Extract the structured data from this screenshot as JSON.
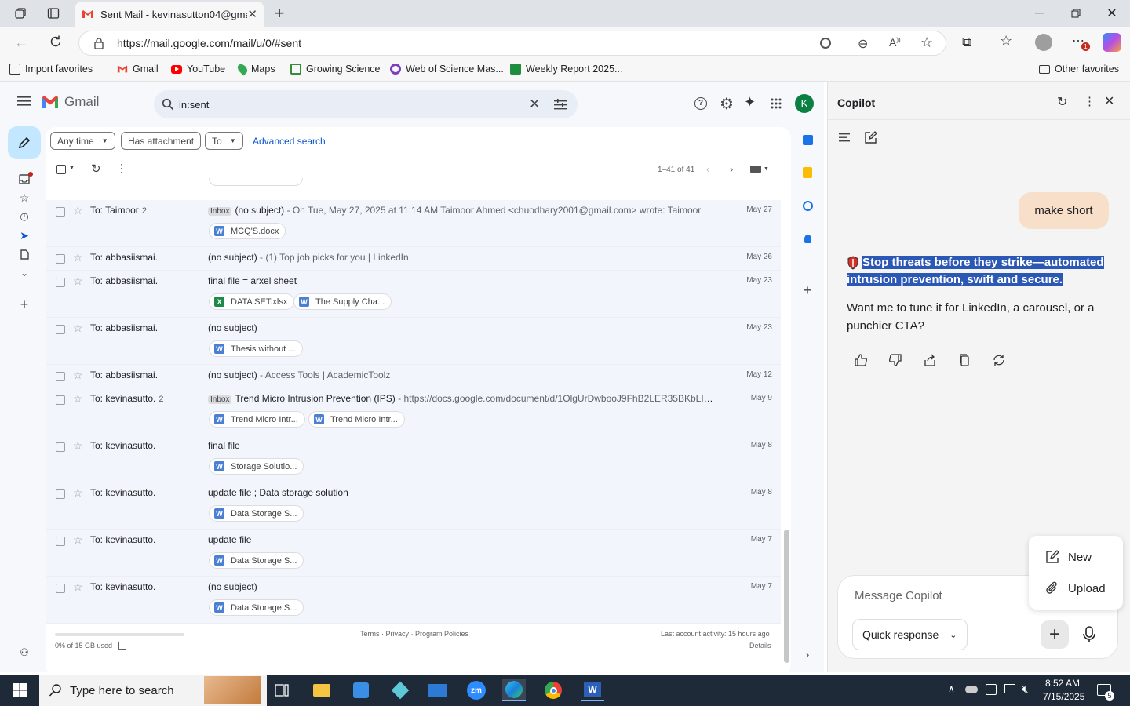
{
  "browser": {
    "tab_title": "Sent Mail - kevinasutton04@gma",
    "url": "https://mail.google.com/mail/u/0/#sent",
    "favorites": [
      {
        "label": "Import favorites",
        "icon": "import-icon"
      },
      {
        "label": "Gmail",
        "icon": "gmail-icon"
      },
      {
        "label": "YouTube",
        "icon": "youtube-icon"
      },
      {
        "label": "Maps",
        "icon": "maps-icon"
      },
      {
        "label": "Growing Science",
        "icon": "growing-science-icon"
      },
      {
        "label": "Web of Science Mas...",
        "icon": "web-of-science-icon"
      },
      {
        "label": "Weekly Report 2025...",
        "icon": "sheets-icon"
      }
    ],
    "other_favorites": "Other favorites",
    "notification_count": "1"
  },
  "gmail": {
    "logo_text": "Gmail",
    "search_value": "in:sent",
    "account_initial": "K",
    "filters": [
      "Any time",
      "Has attachment",
      "To"
    ],
    "advanced_search": "Advanced search",
    "pagination": "1–41 of 41",
    "rows": [
      {
        "to": "To: Taimoor",
        "count": "2",
        "badge": "Inbox",
        "subject": "(no subject)",
        "snippet": " - On Tue, May 27, 2025 at 11:14 AM Taimoor Ahmed <chuodhary2001@gmail.com> wrote: Taimoor",
        "date": "May 27",
        "attachments": [
          {
            "name": "MCQ'S.docx",
            "type": "W"
          }
        ]
      },
      {
        "to": "To: abbasiismai.",
        "count": "",
        "badge": "",
        "subject": "(no subject)",
        "snippet": " - (1) Top job picks for you | LinkedIn",
        "date": "May 26",
        "attachments": []
      },
      {
        "to": "To: abbasiismai.",
        "count": "",
        "badge": "",
        "subject": "final file = arxel sheet",
        "snippet": "",
        "date": "May 23",
        "attachments": [
          {
            "name": "DATA SET.xlsx",
            "type": "X"
          },
          {
            "name": "The Supply Cha...",
            "type": "W"
          }
        ]
      },
      {
        "to": "To: abbasiismai.",
        "count": "",
        "badge": "",
        "subject": "(no subject)",
        "snippet": "",
        "date": "May 23",
        "attachments": [
          {
            "name": "Thesis without ...",
            "type": "W"
          }
        ]
      },
      {
        "to": "To: abbasiismai.",
        "count": "",
        "badge": "",
        "subject": "(no subject)",
        "snippet": " - Access Tools | AcademicToolz",
        "date": "May 12",
        "attachments": []
      },
      {
        "to": "To: kevinasutto.",
        "count": "2",
        "badge": "Inbox",
        "subject": "Trend Micro Intrusion Prevention (IPS)",
        "snippet": " - https://docs.google.com/document/d/1OlgUrDwbooJ9FhB2LER35BKbLI9UNuno/edit?usp...",
        "date": "May 9",
        "attachments": [
          {
            "name": "Trend Micro Intr...",
            "type": "W"
          },
          {
            "name": "Trend Micro Intr...",
            "type": "W"
          }
        ]
      },
      {
        "to": "To: kevinasutto.",
        "count": "",
        "badge": "",
        "subject": "final file",
        "snippet": "",
        "date": "May 8",
        "attachments": [
          {
            "name": "Storage Solutio...",
            "type": "W"
          }
        ]
      },
      {
        "to": "To: kevinasutto.",
        "count": "",
        "badge": "",
        "subject": "update file ; Data storage solution",
        "snippet": "",
        "date": "May 8",
        "attachments": [
          {
            "name": "Data Storage S...",
            "type": "W"
          }
        ]
      },
      {
        "to": "To: kevinasutto.",
        "count": "",
        "badge": "",
        "subject": "update file",
        "snippet": "",
        "date": "May 7",
        "attachments": [
          {
            "name": "Data Storage S...",
            "type": "W"
          }
        ]
      },
      {
        "to": "To: kevinasutto.",
        "count": "",
        "badge": "",
        "subject": "(no subject)",
        "snippet": "",
        "date": "May 7",
        "attachments": [
          {
            "name": "Data Storage S...",
            "type": "W"
          }
        ]
      }
    ],
    "footer": {
      "storage": "0% of 15 GB used",
      "links": "Terms · Privacy · Program Policies",
      "activity": "Last account activity: 15 hours ago",
      "details": "Details"
    }
  },
  "copilot": {
    "title": "Copilot",
    "user_message": "make short",
    "reply_highlighted": "Stop threats before they strike—automated intrusion prevention, swift and secure.",
    "reply_followup": "Want me to tune it for LinkedIn, a carousel, or a punchier CTA?",
    "popup_items": [
      "New",
      "Upload"
    ],
    "input_placeholder": "Message Copilot",
    "quick_response": "Quick response"
  },
  "taskbar": {
    "search_placeholder": "Type here to search",
    "time": "8:52 AM",
    "date": "7/15/2025",
    "notification_count": "5"
  },
  "colors": {
    "gmail_red": "#ea4335",
    "selection": "#2b57b5",
    "user_bubble": "#f7dfc9",
    "account_green": "#0b8043"
  }
}
